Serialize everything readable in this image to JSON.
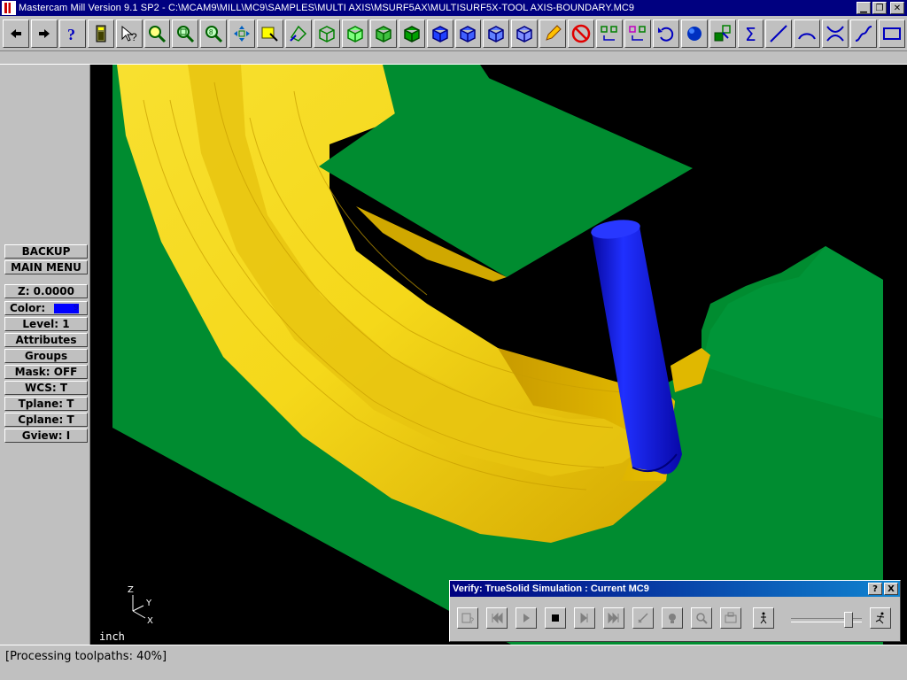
{
  "window": {
    "title": "Mastercam Mill Version 9.1 SP2 - C:\\MCAM9\\MILL\\MC9\\SAMPLES\\MULTI AXIS\\MSURF5AX\\MULTISURF5X-TOOL AXIS-BOUNDARY.MC9",
    "controls": [
      "minimize",
      "restore",
      "close"
    ]
  },
  "toolbar": {
    "icons": [
      "back-arrow-icon",
      "forward-arrow-icon",
      "help-icon",
      "calculator-icon",
      "pointer-help-icon",
      "zoom-icon",
      "zoom-out-icon",
      "zoom-window-icon",
      "pan-icon",
      "select-icon",
      "rotate-icon",
      "cube-top-icon",
      "cube-front-icon",
      "cube-side-icon",
      "cube-iso-icon",
      "cube-blue-1-icon",
      "cube-blue-2-icon",
      "cube-blue-3-icon",
      "cube-blue-4-icon",
      "pencil-icon",
      "no-entry-icon",
      "transform-icon",
      "transform-color-icon",
      "undo-icon",
      "sphere-icon",
      "boxes-icon",
      "sigma-icon",
      "line-icon",
      "arc-icon",
      "trim-icon",
      "spline-icon",
      "rectangle-icon"
    ]
  },
  "menu": {
    "backup": "BACKUP",
    "main_menu": "MAIN MENU",
    "z": "Z:  0.0000",
    "color_label": "Color:",
    "color_value": "9",
    "color_hex": "#0000ff",
    "level": "Level:  1",
    "attributes": "Attributes",
    "groups": "Groups",
    "mask": "Mask:  OFF",
    "wcs": "WCS:   T",
    "tplane": "Tplane:  T",
    "cplane": "Cplane:  T",
    "gview": "Gview:   I"
  },
  "viewport": {
    "units": "inch",
    "axis_labels": {
      "z": "Z",
      "y": "Y",
      "x": "X"
    },
    "colors": {
      "part": "#f5d81a",
      "stock": "#008c30",
      "tool": "#1010e8",
      "background": "#000000"
    }
  },
  "verify": {
    "title": "Verify: TrueSolid Simulation : Current MC9",
    "help": "?",
    "close": "X",
    "buttons": [
      "options-icon",
      "rewind-icon",
      "play-icon",
      "stop-icon",
      "step-icon",
      "fast-forward-icon",
      "cut-icon",
      "light-icon",
      "zoom-part-icon",
      "save-icon",
      "walk-icon",
      "run-icon"
    ],
    "speed_level_percent": 85
  },
  "status": {
    "message": "[Processing toolpaths:   40%]"
  }
}
